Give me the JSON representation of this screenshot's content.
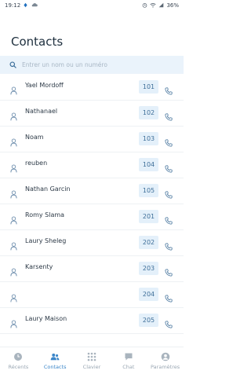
{
  "status_bar": {
    "time": "19:12",
    "battery": "36%"
  },
  "header": {
    "title": "Contacts"
  },
  "search": {
    "placeholder": "Entrer un nom ou un numéro"
  },
  "contacts": [
    {
      "name": "Yael Mordoff",
      "ext": "101"
    },
    {
      "name": "Nathanael",
      "ext": "102"
    },
    {
      "name": "Noam",
      "ext": "103"
    },
    {
      "name": "reuben",
      "ext": "104"
    },
    {
      "name": "Nathan Garcin",
      "ext": "105"
    },
    {
      "name": "Romy Slama",
      "ext": "201"
    },
    {
      "name": "Laury Sheleg",
      "ext": "202"
    },
    {
      "name": "Karsenty",
      "ext": "203"
    },
    {
      "name": "",
      "ext": "204"
    },
    {
      "name": "Laury Maison",
      "ext": "205"
    }
  ],
  "nav": [
    {
      "label": "Récents",
      "icon": "clock-icon",
      "active": false
    },
    {
      "label": "Contacts",
      "icon": "people-icon",
      "active": true
    },
    {
      "label": "Clavier",
      "icon": "keypad-icon",
      "active": false
    },
    {
      "label": "Chat",
      "icon": "chat-icon",
      "active": false
    },
    {
      "label": "Paramètres",
      "icon": "settings-icon",
      "active": false
    }
  ],
  "colors": {
    "accent": "#3b86c9",
    "ext_bg": "#e4f0fa",
    "search_bg": "#eaf3fb",
    "inactive": "#9aa7b3"
  }
}
